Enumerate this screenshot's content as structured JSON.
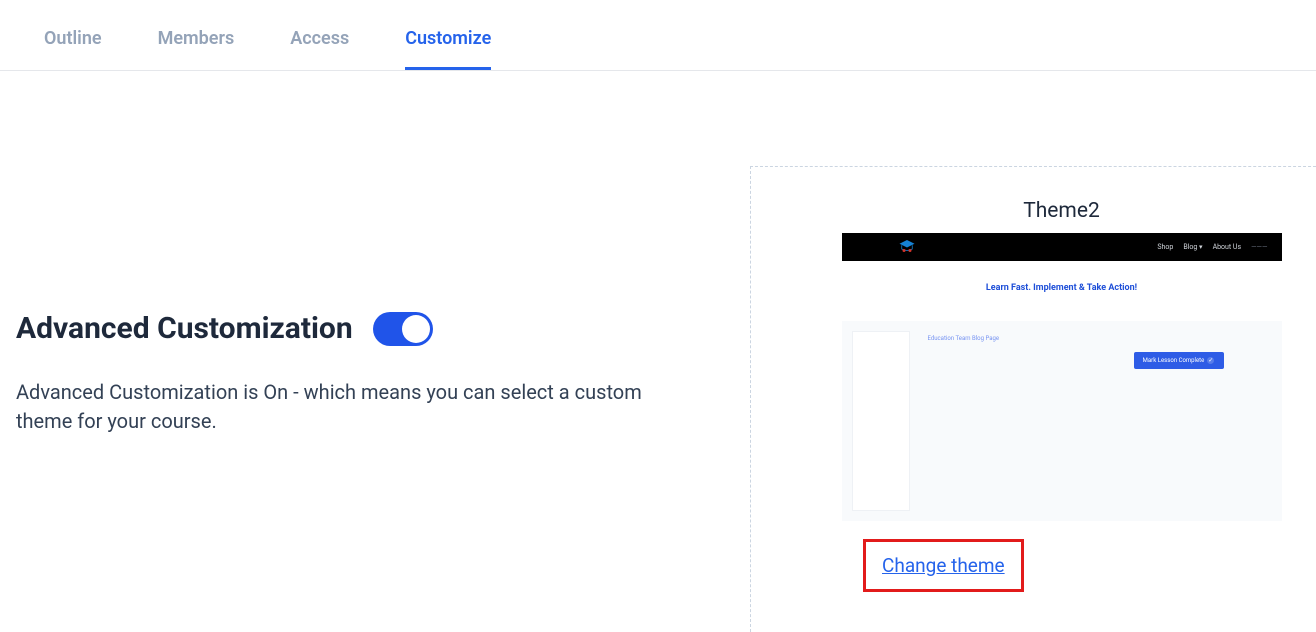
{
  "tabs": {
    "outline": "Outline",
    "members": "Members",
    "access": "Access",
    "customize": "Customize"
  },
  "section": {
    "title": "Advanced Customization",
    "description": "Advanced Customization is On - which means you can select a custom theme for your course."
  },
  "theme": {
    "name": "Theme2",
    "change_link": "Change theme"
  },
  "preview": {
    "nav": {
      "shop": "Shop",
      "blog": "Blog ▾",
      "about": "About Us",
      "extra": "———"
    },
    "hero": "Learn Fast. Implement & Take Action!",
    "breadcrumb": "Education Team Blog Page",
    "button": "Mark Lesson Complete"
  }
}
